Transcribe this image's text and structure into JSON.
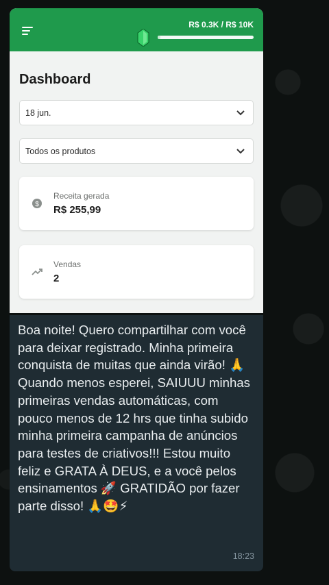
{
  "header": {
    "progress_label": "R$ 0.3K / R$ 10K",
    "progress_fraction": 0.03,
    "accent_color": "#1f9a4c",
    "menu_icon": "hamburger-icon",
    "badge_icon": "gem-icon"
  },
  "page": {
    "title": "Dashboard"
  },
  "filters": {
    "date_value": "18 jun.",
    "product_value": "Todos os produtos"
  },
  "stats": [
    {
      "label": "Receita gerada",
      "value": "R$ 255,99",
      "icon": "coin-icon"
    },
    {
      "label": "Vendas",
      "value": "2",
      "icon": "trending-up-icon"
    }
  ],
  "message": {
    "text": "Boa noite! Quero compartilhar com você para deixar registrado. Minha primeira conquista de muitas que ainda virão! 🙏\nQuando menos esperei, SAIUUU minhas primeiras vendas automáticas, com pouco menos de 12 hrs que tinha subido minha primeira campanha de anúncios para testes de criativos!!! Estou muito feliz e GRATA À DEUS, e a você pelos ensinamentos 🚀 GRATIDÃO por fazer parte disso! 🙏🤩⚡",
    "time": "18:23"
  }
}
